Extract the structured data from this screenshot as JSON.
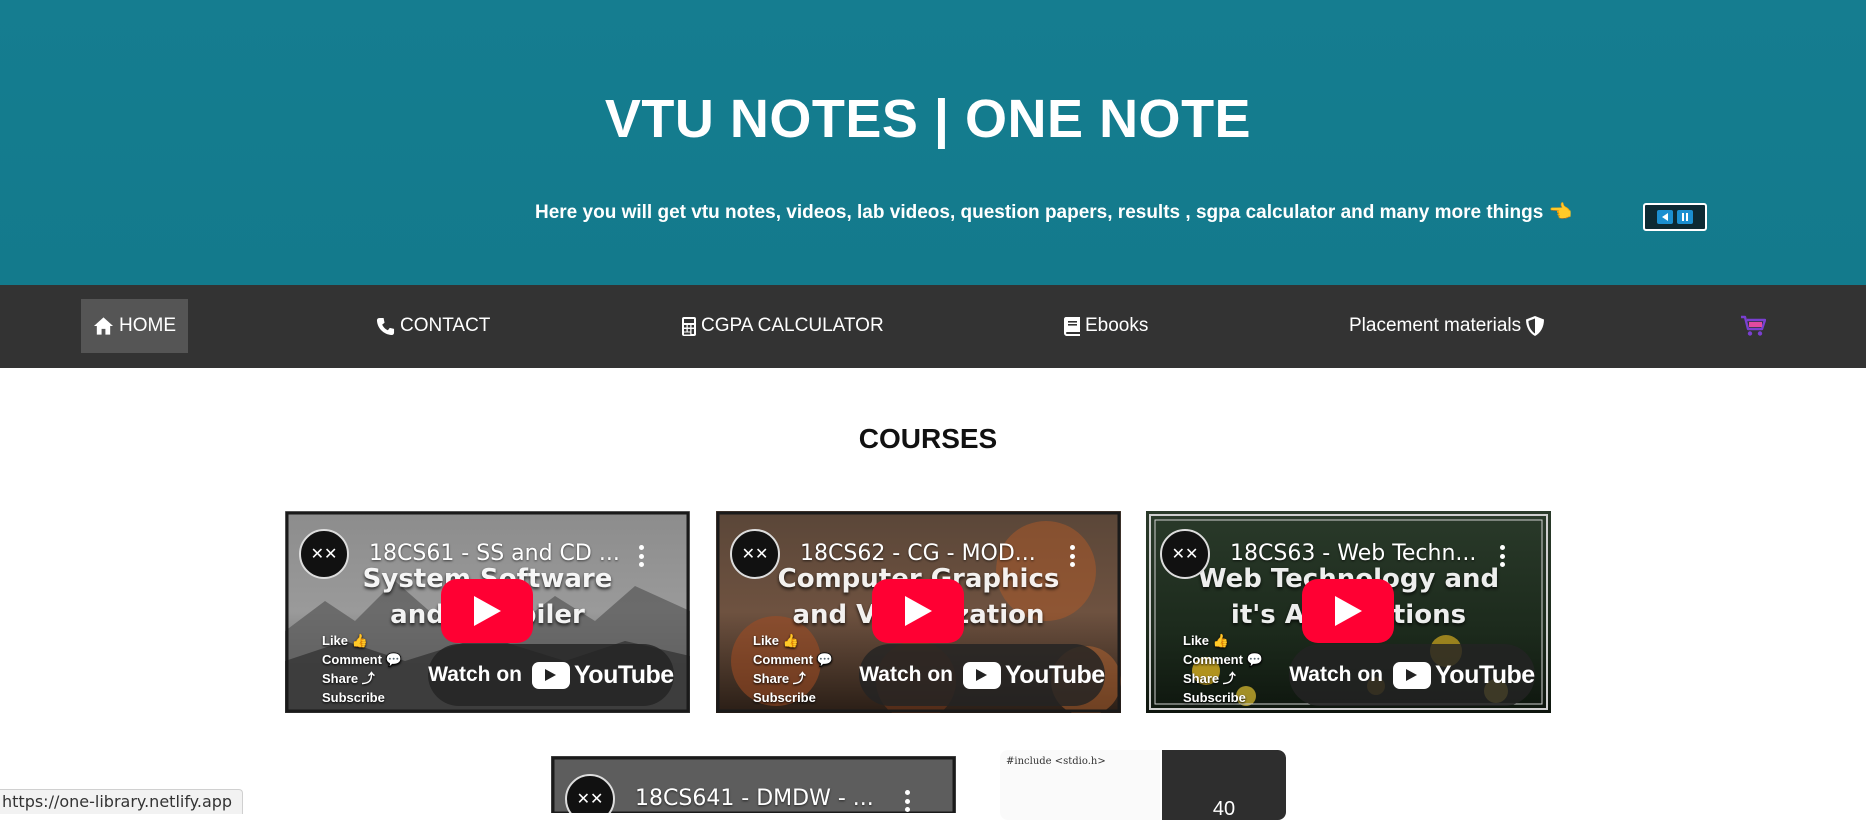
{
  "header": {
    "title": "VTU NOTES | ONE NOTE",
    "tagline": "Here you will get vtu notes, videos, lab videos, question papers, results , sgpa calculator and many more things 👈"
  },
  "nav": {
    "items": [
      {
        "label": "HOME",
        "icon": "home-icon"
      },
      {
        "label": "CONTACT",
        "icon": "phone-icon"
      },
      {
        "label": "CGPA CALCULATOR",
        "icon": "calculator-icon"
      },
      {
        "label": "Ebooks",
        "icon": "book-icon"
      },
      {
        "label": "Placement materials",
        "icon": "shield-icon"
      }
    ],
    "cart_icon": "cart-icon"
  },
  "courses": {
    "heading": "COURSES",
    "videos": [
      {
        "title": "18CS61 - SS and CD ...",
        "overlay_line1": "System Software",
        "overlay_line2": "and Compiler",
        "watch_label": "Watch on",
        "brand": "YouTube"
      },
      {
        "title": "18CS62 - CG - MOD...",
        "overlay_line1": "Computer Graphics",
        "overlay_line2": "and Visualization",
        "watch_label": "Watch on",
        "brand": "YouTube"
      },
      {
        "title": "18CS63 - Web Techn...",
        "overlay_line1": "Web Technology and",
        "overlay_line2": "it's Applications",
        "watch_label": "Watch on",
        "brand": "YouTube"
      },
      {
        "title": "18CS641 - DMDW - ..."
      }
    ],
    "side_notes": [
      "Like 👍",
      "Comment 💬",
      "Share ⤴",
      "Subscribe"
    ],
    "second_card_text": "#include <stdio.h>",
    "second_card_number": "40"
  },
  "status_bar": {
    "url": "https://one-library.netlify.app"
  },
  "colors": {
    "header_bg": "#157d90",
    "nav_bg": "#333333",
    "nav_active": "#555555",
    "play_red": "#ff0033"
  }
}
